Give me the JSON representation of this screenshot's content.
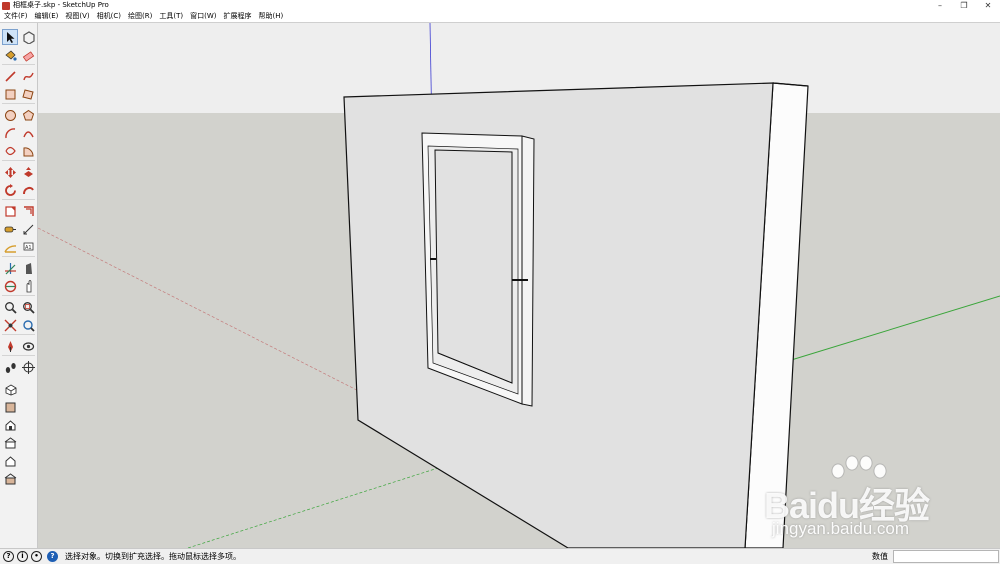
{
  "window": {
    "title": "相框桌子.skp - SketchUp Pro",
    "minimize": "–",
    "restore": "❐",
    "close": "✕"
  },
  "menu": [
    "文件(F)",
    "编辑(E)",
    "视图(V)",
    "相机(C)",
    "绘图(R)",
    "工具(T)",
    "窗口(W)",
    "扩展程序",
    "帮助(H)"
  ],
  "tools": [
    {
      "name": "select-icon",
      "active": true
    },
    {
      "name": "make-component-icon"
    },
    {
      "name": "paint-bucket-icon"
    },
    {
      "name": "eraser-icon"
    },
    {
      "name": "line-icon"
    },
    {
      "name": "freehand-icon"
    },
    {
      "name": "rectangle-icon"
    },
    {
      "name": "rotated-rectangle-icon"
    },
    {
      "name": "circle-icon"
    },
    {
      "name": "polygon-icon"
    },
    {
      "name": "arc-icon"
    },
    {
      "name": "two-point-arc-icon"
    },
    {
      "name": "three-point-arc-icon"
    },
    {
      "name": "pie-icon"
    },
    {
      "name": "move-icon"
    },
    {
      "name": "push-pull-icon"
    },
    {
      "name": "rotate-icon"
    },
    {
      "name": "follow-me-icon"
    },
    {
      "name": "scale-icon"
    },
    {
      "name": "offset-icon"
    },
    {
      "name": "tape-measure-icon"
    },
    {
      "name": "dimension-icon"
    },
    {
      "name": "protractor-icon"
    },
    {
      "name": "text-icon"
    },
    {
      "name": "axes-icon"
    },
    {
      "name": "3d-text-icon"
    },
    {
      "name": "orbit-icon"
    },
    {
      "name": "pan-icon"
    },
    {
      "name": "zoom-icon"
    },
    {
      "name": "zoom-window-icon"
    },
    {
      "name": "zoom-extents-icon"
    },
    {
      "name": "previous-view-icon"
    },
    {
      "name": "position-camera-icon"
    },
    {
      "name": "look-around-icon"
    },
    {
      "name": "walk-icon"
    },
    {
      "name": "section-plane-icon"
    },
    {
      "name": "iso-view-icon"
    },
    {
      "name": "top-view-icon"
    },
    {
      "name": "front-view-icon"
    },
    {
      "name": "right-view-icon"
    },
    {
      "name": "back-view-icon"
    },
    {
      "name": "left-view-icon"
    }
  ],
  "status": {
    "text": "选择对象。切换到扩充选择。拖动鼠标选择多项。",
    "measurements_label": "数值",
    "measurements_value": ""
  },
  "watermark": {
    "brand": "Baidu经验",
    "url": "jingyan.baidu.com"
  },
  "colors": {
    "sky": "#eeeeee",
    "ground": "#d2d2cd",
    "wall": "#e1e1e1",
    "wall_side": "#fcfcfc",
    "red_axis": "#c47b7b",
    "green_axis": "#3aa53a",
    "blue_axis": "#3c3cd2",
    "edge": "#111111",
    "accent": "#1e5fb4"
  }
}
